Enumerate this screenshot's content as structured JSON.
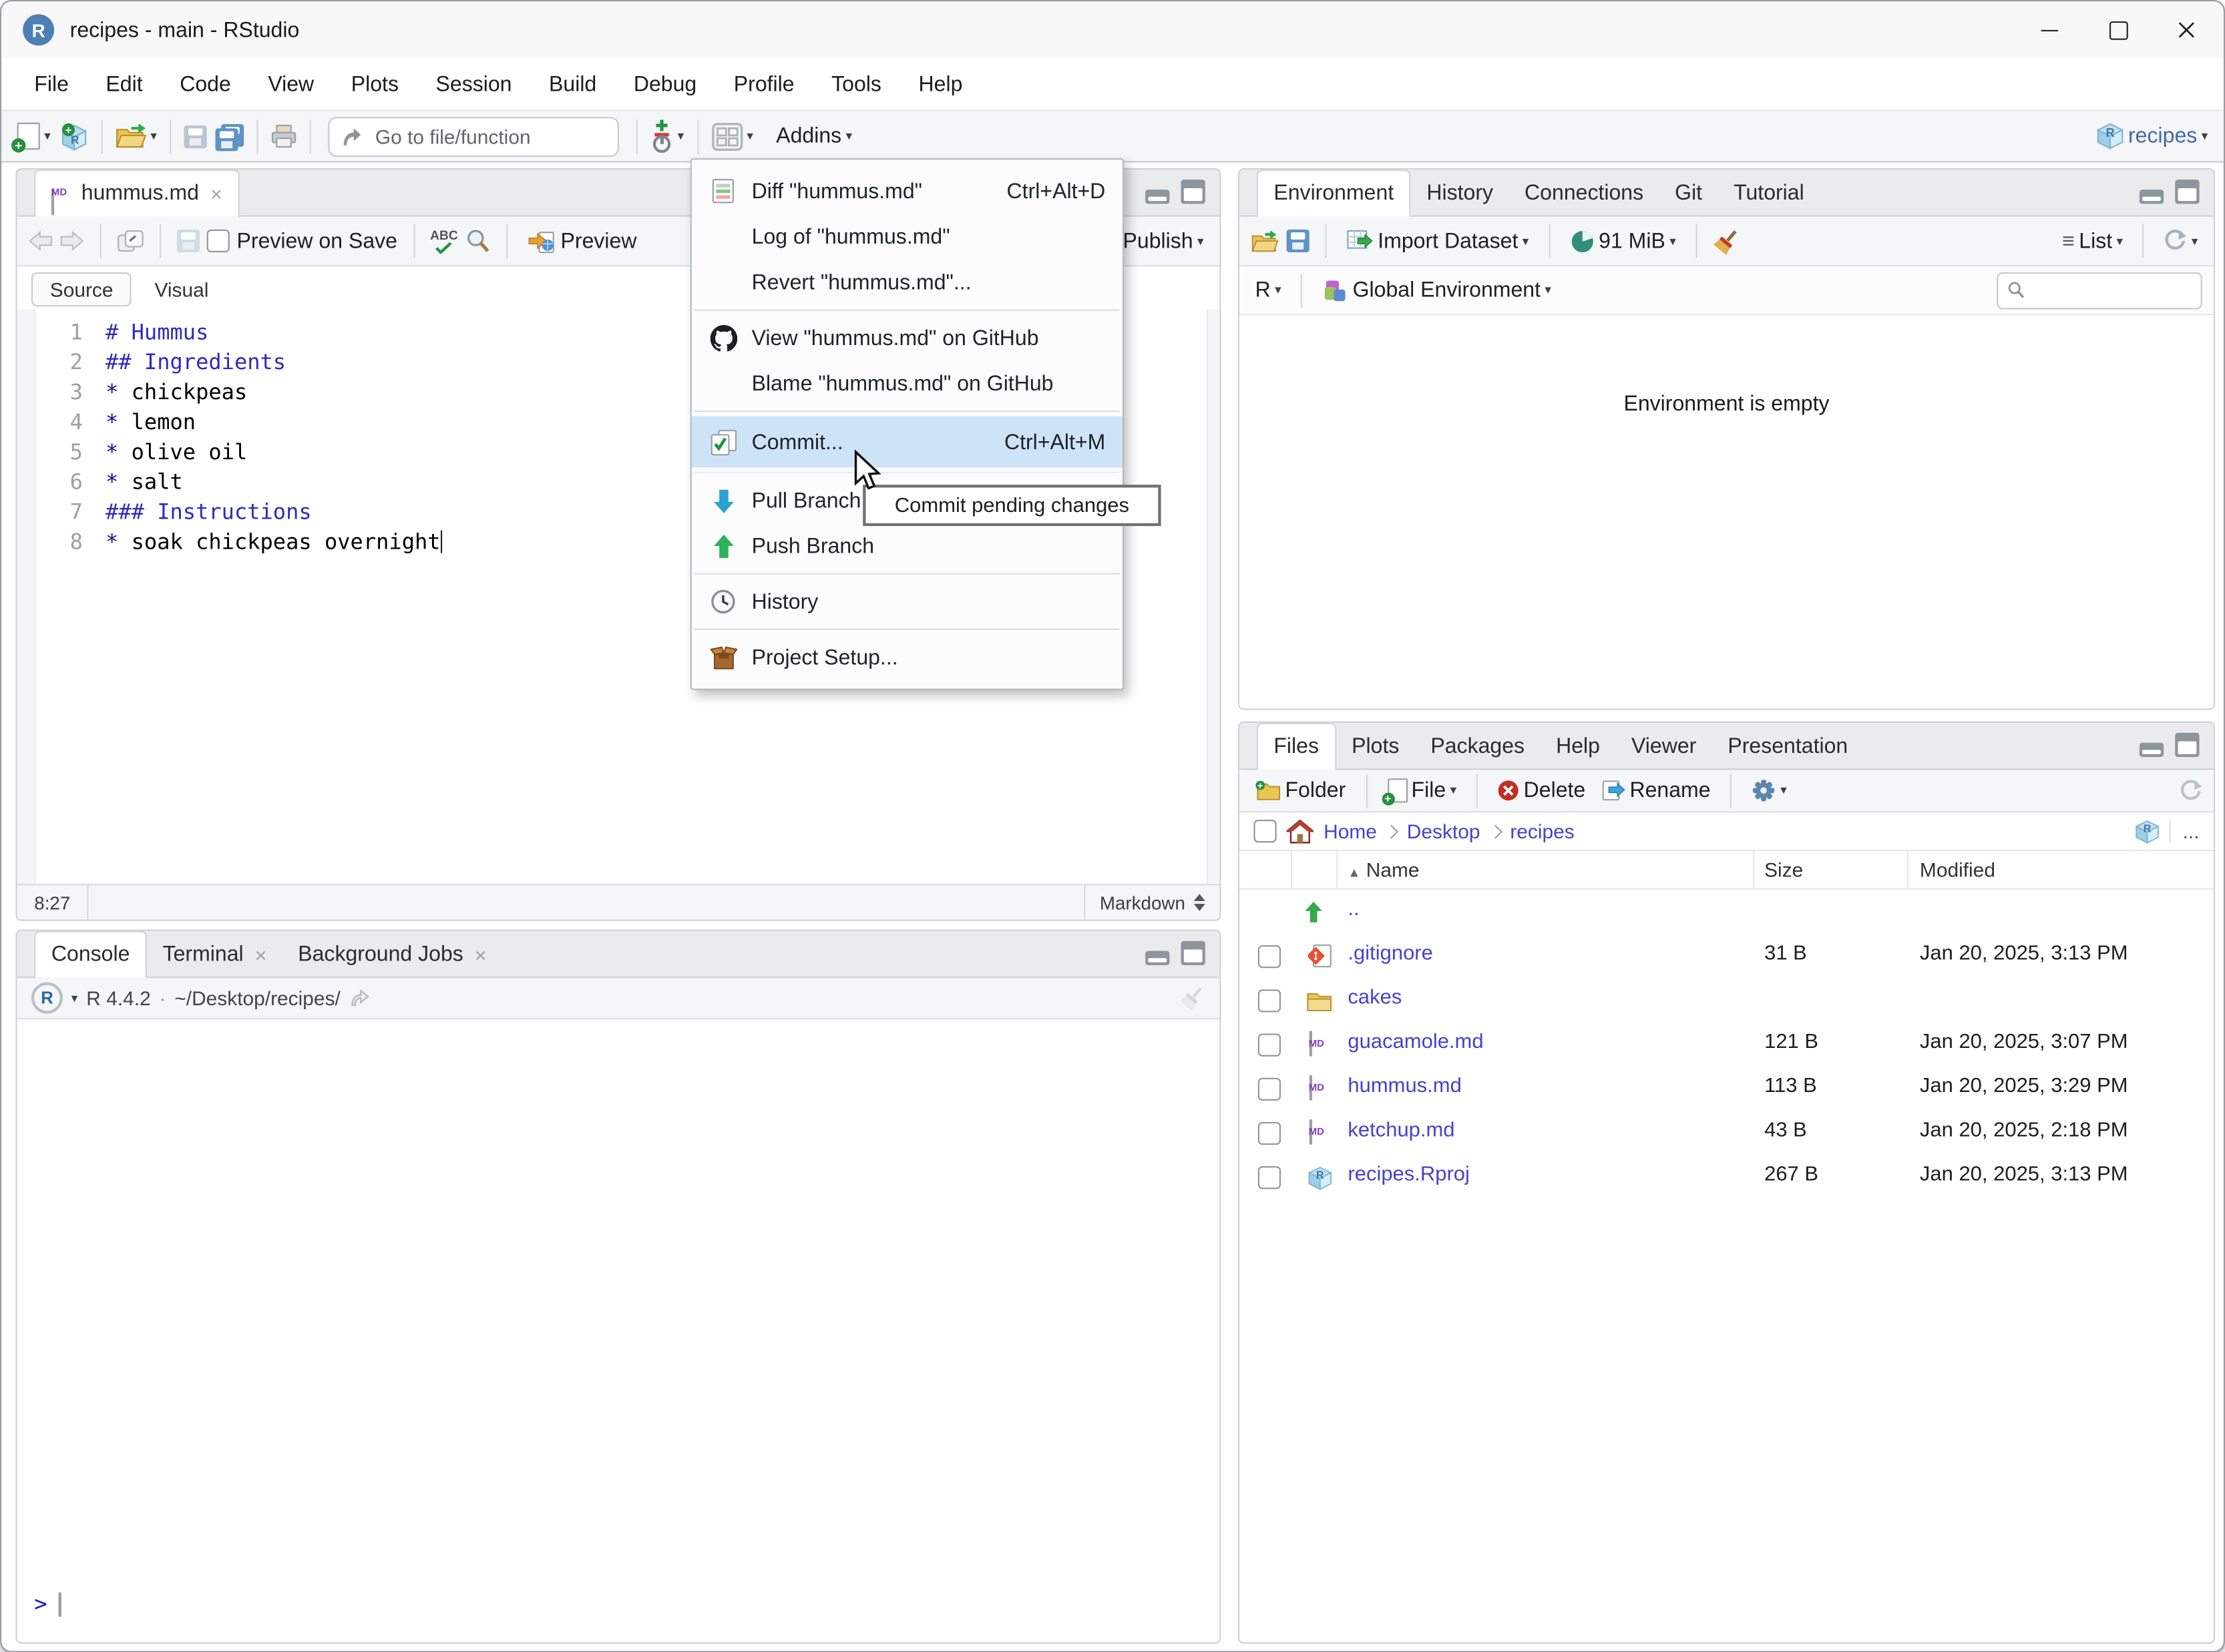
{
  "colors": {
    "selection_highlight": "#cde4f7",
    "link_blue": "#4343cd",
    "heading_blue": "#2c2cbe",
    "prompt_blue": "#1414c8",
    "toolbar_bg": "#f5f6f7"
  },
  "window": {
    "title": "recipes - main - RStudio"
  },
  "menubar": {
    "items": [
      "File",
      "Edit",
      "Code",
      "View",
      "Plots",
      "Session",
      "Build",
      "Debug",
      "Profile",
      "Tools",
      "Help"
    ]
  },
  "toolbar": {
    "goto_placeholder": "Go to file/function",
    "addins_label": "Addins",
    "project_label": "recipes"
  },
  "git_menu": {
    "tooltip": "Commit pending changes",
    "items": [
      {
        "label": "Diff \"hummus.md\"",
        "shortcut": "Ctrl+Alt+D"
      },
      {
        "label": "Log of \"hummus.md\"",
        "shortcut": ""
      },
      {
        "label": "Revert \"hummus.md\"...",
        "shortcut": ""
      },
      {
        "label": "View \"hummus.md\" on GitHub",
        "shortcut": ""
      },
      {
        "label": "Blame \"hummus.md\" on GitHub",
        "shortcut": ""
      },
      {
        "label": "Commit...",
        "shortcut": "Ctrl+Alt+M"
      },
      {
        "label": "Pull Branch",
        "shortcut": ""
      },
      {
        "label": "Push Branch",
        "shortcut": ""
      },
      {
        "label": "History",
        "shortcut": ""
      },
      {
        "label": "Project Setup...",
        "shortcut": ""
      }
    ]
  },
  "source_pane": {
    "tab_label": "hummus.md",
    "toolbar": {
      "preview_on_save": "Preview on Save",
      "preview": "Preview",
      "publish": "Publish"
    },
    "mode_tabs": {
      "source": "Source",
      "visual": "Visual"
    },
    "lines": [
      {
        "num": "1",
        "head": "# Hummus"
      },
      {
        "num": "2",
        "head": "## Ingredients"
      },
      {
        "num": "3",
        "bullet": "*",
        "text": " chickpeas"
      },
      {
        "num": "4",
        "bullet": "*",
        "text": " lemon"
      },
      {
        "num": "5",
        "bullet": "*",
        "text": " olive oil"
      },
      {
        "num": "6",
        "bullet": "*",
        "text": " salt"
      },
      {
        "num": "7",
        "head": "### Instructions"
      },
      {
        "num": "8",
        "bullet": "*",
        "text": " soak chickpeas overnight"
      }
    ],
    "status": {
      "cursor_position": "8:27",
      "mode": "Markdown"
    }
  },
  "console_pane": {
    "tabs": [
      "Console",
      "Terminal",
      "Background Jobs"
    ],
    "r_version": "R 4.4.2",
    "dot": "·",
    "working_dir": "~/Desktop/recipes/",
    "prompt": ">"
  },
  "environment_pane": {
    "tabs": [
      "Environment",
      "History",
      "Connections",
      "Git",
      "Tutorial"
    ],
    "toolbar": {
      "import_dataset": "Import Dataset",
      "memory": "91 MiB",
      "list_view": "List"
    },
    "language": "R",
    "scope": "Global Environment",
    "empty_message": "Environment is empty"
  },
  "files_pane": {
    "tabs": [
      "Files",
      "Plots",
      "Packages",
      "Help",
      "Viewer",
      "Presentation"
    ],
    "toolbar": {
      "new_folder": "Folder",
      "new_file": "File",
      "delete": "Delete",
      "rename": "Rename"
    },
    "breadcrumb": [
      "Home",
      "Desktop",
      "recipes"
    ],
    "more_button": "...",
    "columns": {
      "name": "Name",
      "size": "Size",
      "modified": "Modified"
    },
    "rows": [
      {
        "name": "..",
        "size": "",
        "modified": ""
      },
      {
        "name": ".gitignore",
        "size": "31 B",
        "modified": "Jan 20, 2025, 3:13 PM"
      },
      {
        "name": "cakes",
        "size": "",
        "modified": ""
      },
      {
        "name": "guacamole.md",
        "size": "121 B",
        "modified": "Jan 20, 2025, 3:07 PM"
      },
      {
        "name": "hummus.md",
        "size": "113 B",
        "modified": "Jan 20, 2025, 3:29 PM"
      },
      {
        "name": "ketchup.md",
        "size": "43 B",
        "modified": "Jan 20, 2025, 2:18 PM"
      },
      {
        "name": "recipes.Rproj",
        "size": "267 B",
        "modified": "Jan 20, 2025, 3:13 PM"
      }
    ]
  },
  "icon_glyphs": {
    "md": "MD",
    "abc": "ABC",
    "r": "R"
  }
}
